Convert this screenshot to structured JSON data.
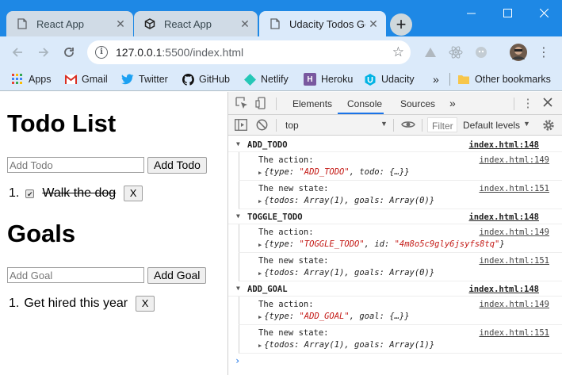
{
  "browser": {
    "tabs": [
      {
        "title": "React App",
        "active": false,
        "icon": "document-icon"
      },
      {
        "title": "React App",
        "active": false,
        "icon": "codesandbox-icon"
      },
      {
        "title": "Udacity Todos Go",
        "active": true,
        "icon": "document-icon"
      }
    ],
    "url_host": "127.0.0.1",
    "url_rest": ":5500/index.html",
    "bookmarks": [
      {
        "label": "Apps",
        "icon": "apps-grid-icon"
      },
      {
        "label": "Gmail",
        "icon": "gmail-icon"
      },
      {
        "label": "Twitter",
        "icon": "twitter-icon"
      },
      {
        "label": "GitHub",
        "icon": "github-icon"
      },
      {
        "label": "Netlify",
        "icon": "netlify-icon"
      },
      {
        "label": "Heroku",
        "icon": "heroku-icon"
      },
      {
        "label": "Udacity",
        "icon": "udacity-icon"
      }
    ],
    "overflow": "»",
    "other_bookmarks": "Other bookmarks",
    "colors": {
      "frame": "#1e88e5",
      "toolbar": "#dbeafa",
      "accent": "#1a73e8"
    }
  },
  "page": {
    "todo_heading": "Todo List",
    "todo_placeholder": "Add Todo",
    "todo_button": "Add Todo",
    "todos": [
      {
        "index": "1.",
        "text": "Walk the dog",
        "complete": true,
        "remove": "X"
      }
    ],
    "goals_heading": "Goals",
    "goal_placeholder": "Add Goal",
    "goal_button": "Add Goal",
    "goals": [
      {
        "index": "1.",
        "text": "Get hired this year",
        "remove": "X"
      }
    ]
  },
  "devtools": {
    "tabs": [
      "Elements",
      "Console",
      "Sources"
    ],
    "active_tab": "Console",
    "more": "»",
    "context": "top",
    "filter_placeholder": "Filter",
    "levels": "Default levels",
    "groups": [
      {
        "name": "ADD_TODO",
        "source": "index.html:148",
        "action_label": "The action:",
        "action_source": "index.html:149",
        "action_pre": "{type: ",
        "action_type": "\"ADD_TODO\"",
        "action_post": ", todo: {…}}",
        "state_label": "The new state:",
        "state_source": "index.html:151",
        "state_obj": "{todos: Array(1), goals: Array(0)}"
      },
      {
        "name": "TOGGLE_TODO",
        "source": "index.html:148",
        "action_label": "The action:",
        "action_source": "index.html:149",
        "action_pre": "{type: ",
        "action_type": "\"TOGGLE_TODO\"",
        "action_post_pre": ", id: ",
        "action_id": "\"4m8o5c9gly6jsyfs8tq\"",
        "action_post": "}",
        "state_label": "The new state:",
        "state_source": "index.html:151",
        "state_obj": "{todos: Array(1), goals: Array(0)}"
      },
      {
        "name": "ADD_GOAL",
        "source": "index.html:148",
        "action_label": "The action:",
        "action_source": "index.html:149",
        "action_pre": "{type: ",
        "action_type": "\"ADD_GOAL\"",
        "action_post": ", goal: {…}}",
        "state_label": "The new state:",
        "state_source": "index.html:151",
        "state_obj": "{todos: Array(1), goals: Array(1)}"
      }
    ],
    "prompt": "›"
  }
}
